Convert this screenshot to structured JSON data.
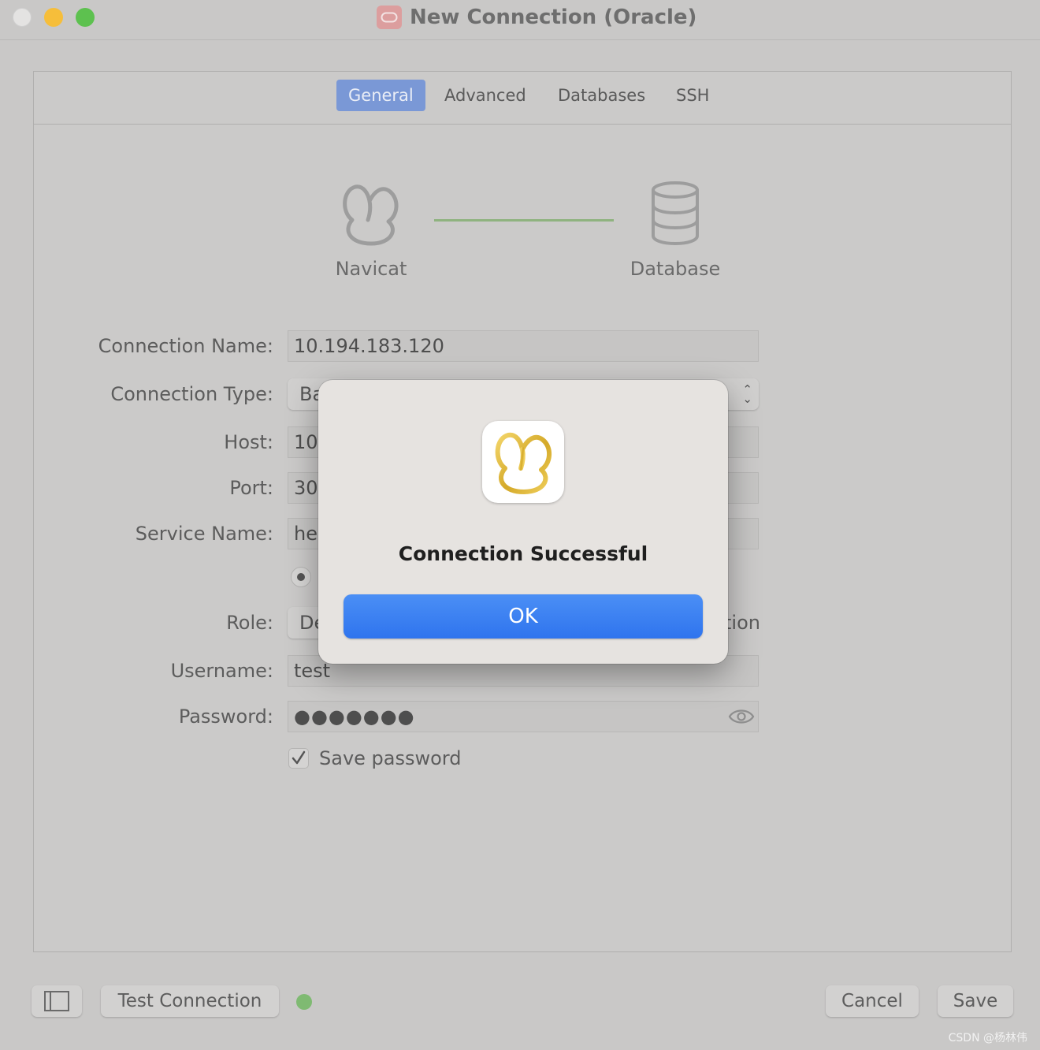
{
  "window": {
    "title": "New Connection (Oracle)",
    "icon": "oracle-icon"
  },
  "tabs": [
    {
      "label": "General",
      "active": true
    },
    {
      "label": "Advanced",
      "active": false
    },
    {
      "label": "Databases",
      "active": false
    },
    {
      "label": "SSH",
      "active": false
    }
  ],
  "illustration": {
    "left_label": "Navicat",
    "right_label": "Database",
    "link_color": "#8fb37f"
  },
  "form": {
    "connection_name": {
      "label": "Connection Name:",
      "value": "10.194.183.120"
    },
    "connection_type": {
      "label": "Connection Type:",
      "value": "Ba"
    },
    "host": {
      "label": "Host:",
      "value": "10."
    },
    "port": {
      "label": "Port:",
      "value": "30"
    },
    "service_name": {
      "label": "Service Name:",
      "value": "he"
    },
    "role": {
      "label": "Role:",
      "value": "De",
      "extra_fragment": "tion"
    },
    "username": {
      "label": "Username:",
      "value": "test"
    },
    "password": {
      "label": "Password:",
      "value": "●●●●●●●"
    },
    "save_password": {
      "label": "Save password",
      "checked": true
    }
  },
  "bottom": {
    "test_connection": "Test Connection",
    "status_color": "#7fba72",
    "cancel": "Cancel",
    "save": "Save"
  },
  "dialog": {
    "title": "Connection Successful",
    "ok": "OK",
    "accent": "#3a7ff0"
  },
  "watermark": "CSDN @杨林伟"
}
